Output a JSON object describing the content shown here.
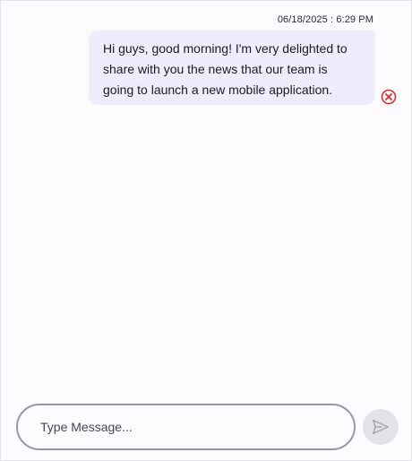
{
  "message": {
    "timestamp": "06/18/2025 : 6:29 PM",
    "text": "Hi guys, good morning! I'm very delighted to share with you the news that our team is going to launch a new mobile application.",
    "status_icon": "error-circle-icon",
    "bubble_color": "#f1ecfb",
    "error_color": "#d32f2f"
  },
  "composer": {
    "placeholder": "Type Message...",
    "value": "",
    "send_icon": "send-icon"
  }
}
